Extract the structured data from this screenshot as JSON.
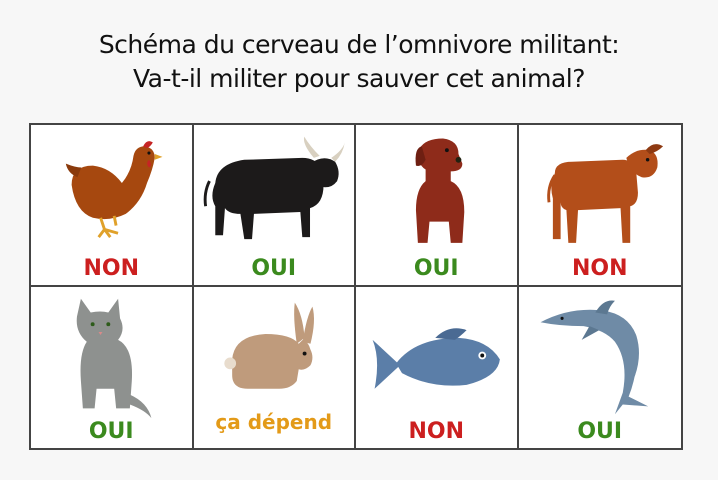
{
  "title_lines": [
    "Schéma du cerveau de l’omnivore militant:",
    "Va-t-il militer pour sauver cet animal?"
  ],
  "cells": [
    {
      "animal": "chicken-icon",
      "verdict": "NON",
      "color": "#cc1f1f"
    },
    {
      "animal": "bull-icon",
      "verdict": "OUI",
      "color": "#3b8a1e"
    },
    {
      "animal": "dog-icon",
      "verdict": "OUI",
      "color": "#3b8a1e"
    },
    {
      "animal": "calf-icon",
      "verdict": "NON",
      "color": "#cc1f1f"
    },
    {
      "animal": "cat-icon",
      "verdict": "OUI",
      "color": "#3b8a1e"
    },
    {
      "animal": "rabbit-icon",
      "verdict": "ça dépend",
      "color": "#e39a18"
    },
    {
      "animal": "fish-icon",
      "verdict": "NON",
      "color": "#cc1f1f"
    },
    {
      "animal": "dolphin-icon",
      "verdict": "OUI",
      "color": "#3b8a1e"
    }
  ]
}
